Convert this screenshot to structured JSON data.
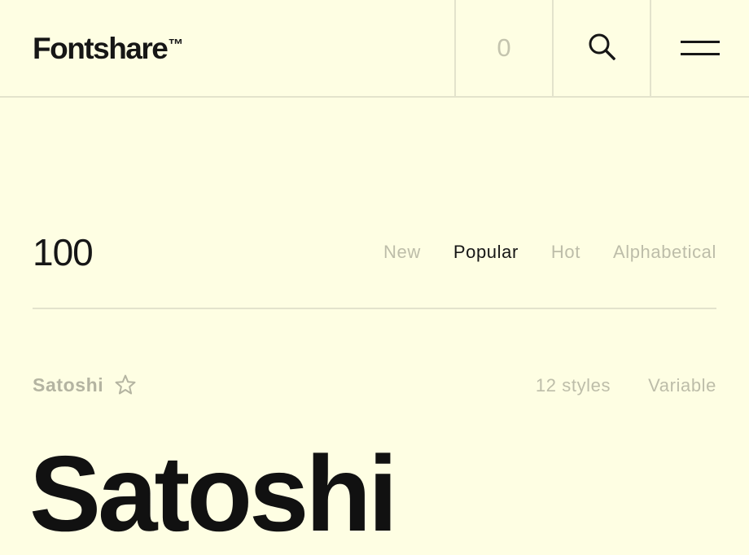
{
  "header": {
    "logo_text": "Fontshare",
    "logo_mark": "™",
    "cart_count": "0",
    "search_icon": "search-icon",
    "menu_icon": "hamburger-menu-icon"
  },
  "catalog": {
    "total_count": "100",
    "sort_options": [
      {
        "label": "New",
        "active": false
      },
      {
        "label": "Popular",
        "active": true
      },
      {
        "label": "Hot",
        "active": false
      },
      {
        "label": "Alphabetical",
        "active": false
      }
    ]
  },
  "font_card": {
    "name": "Satoshi",
    "favorite_icon": "star-icon",
    "styles": "12 styles",
    "type": "Variable",
    "preview_text": "Satoshi"
  },
  "colors": {
    "background": "#fefee3",
    "text": "#161616",
    "muted": "#bdbda9",
    "border": "#e3e3cc"
  }
}
